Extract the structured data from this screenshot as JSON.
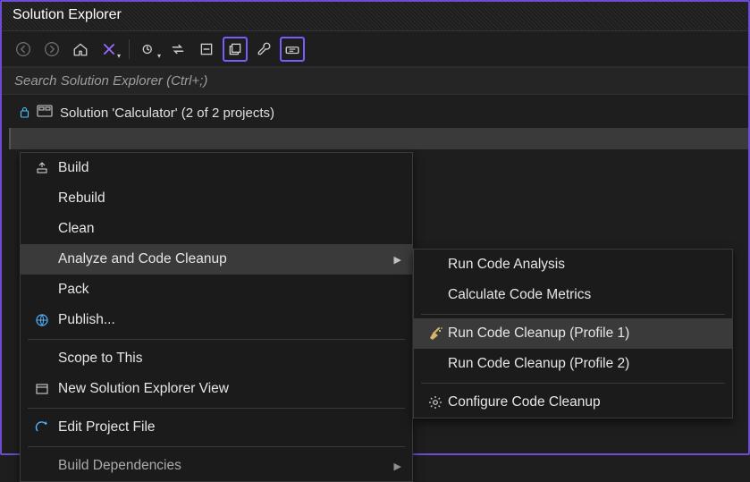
{
  "panel": {
    "title": "Solution Explorer"
  },
  "search": {
    "placeholder": "Search Solution Explorer (Ctrl+;)"
  },
  "tree": {
    "solution_label": "Solution 'Calculator' (2 of 2 projects)"
  },
  "context_menu": {
    "build": "Build",
    "rebuild": "Rebuild",
    "clean": "Clean",
    "analyze": "Analyze and Code Cleanup",
    "pack": "Pack",
    "publish": "Publish...",
    "scope": "Scope to This",
    "new_view": "New Solution Explorer View",
    "edit_project": "Edit Project File",
    "build_deps": "Build Dependencies"
  },
  "submenu": {
    "run_analysis": "Run Code Analysis",
    "calc_metrics": "Calculate Code Metrics",
    "cleanup_p1": "Run Code Cleanup (Profile 1)",
    "cleanup_p2": "Run Code Cleanup (Profile 2)",
    "configure": "Configure Code Cleanup"
  }
}
